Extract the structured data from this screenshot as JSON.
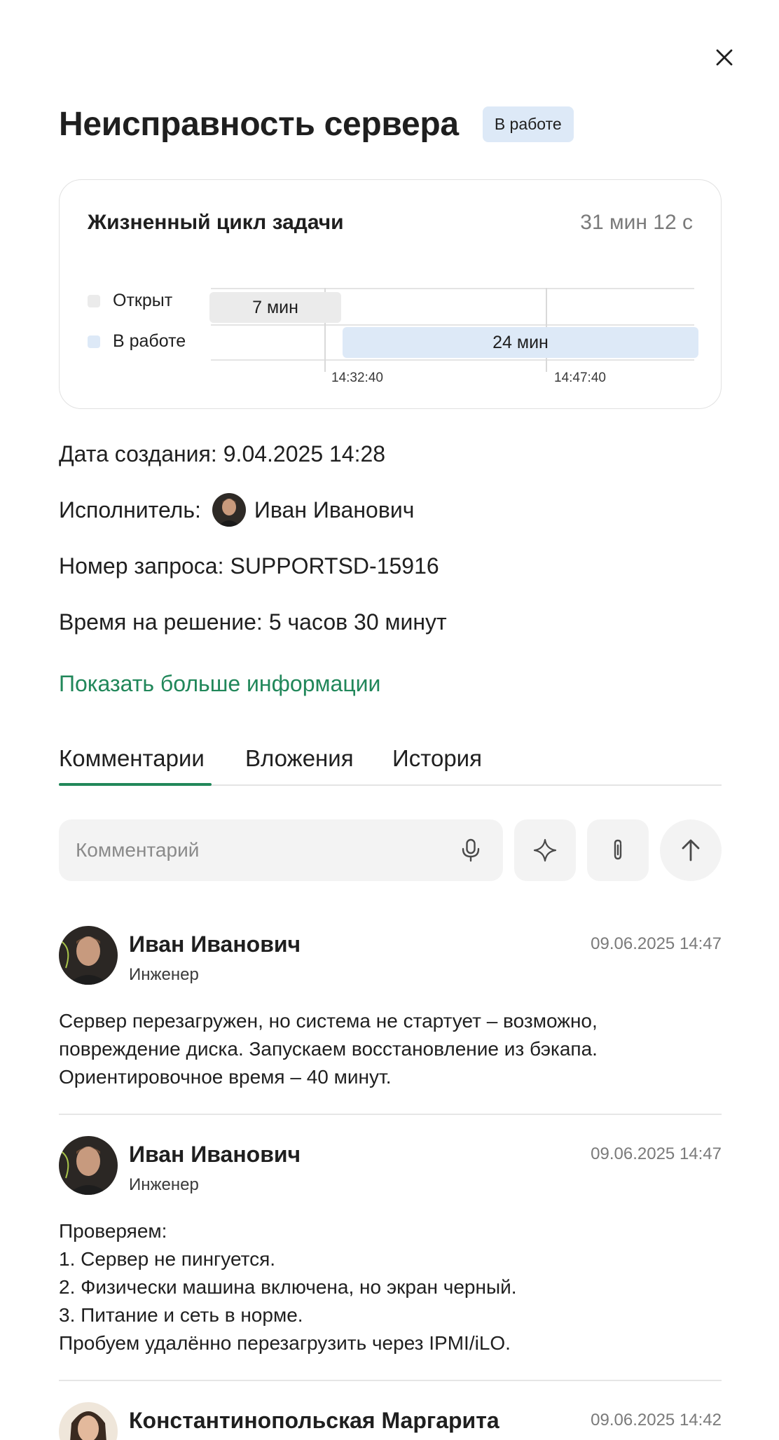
{
  "title": "Неисправность сервера",
  "status": "В работе",
  "lifecycle": {
    "title": "Жизненный цикл задачи",
    "total": "31 мин 12 с",
    "states": [
      {
        "label": "Открыт",
        "duration": "7 мин",
        "color": "#ebebeb"
      },
      {
        "label": "В работе",
        "duration": "24 мин",
        "color": "#dde9f7"
      }
    ],
    "ticks": [
      "14:32:40",
      "14:47:40"
    ]
  },
  "info": {
    "created_label": "Дата создания:",
    "created_value": "9.04.2025 14:28",
    "assignee_label": "Исполнитель:",
    "assignee_name": "Иван Иванович",
    "request_label": "Номер запроса:",
    "request_value": "SUPPORTSD-15916",
    "resolve_label": "Время на решение:",
    "resolve_value": "5 часов 30 минут"
  },
  "more_link": "Показать больше информации",
  "tabs": [
    {
      "label": "Комментарии",
      "active": true
    },
    {
      "label": "Вложения",
      "active": false
    },
    {
      "label": "История",
      "active": false
    }
  ],
  "composer": {
    "placeholder": "Комментарий",
    "mic_icon": "microphone-icon",
    "ai_icon": "sparkle-icon",
    "attach_icon": "paperclip-icon",
    "send_icon": "arrow-up-icon"
  },
  "comments": [
    {
      "author": "Иван Иванович",
      "role": "Инженер",
      "time": "09.06.2025 14:47",
      "lines": [
        "Сервер перезагружен, но система не стартует – возможно,",
        "повреждение диска. Запускаем восстановление из бэкапа.",
        "Ориентировочное время – 40 минут."
      ]
    },
    {
      "author": "Иван Иванович",
      "role": "Инженер",
      "time": "09.06.2025 14:47",
      "lines": [
        "Проверяем:",
        "1. Сервер не пингуется.",
        "2. Физически машина включена, но экран черный.",
        "3. Питание и сеть в норме.",
        "Пробуем удалённо перезагрузить через IPMI/iLO."
      ]
    },
    {
      "author": "Константинопольская Маргарита",
      "role": "",
      "time": "09.06.2025 14:42",
      "lines": []
    }
  ],
  "colors": {
    "accent": "#21875a",
    "status_badge_bg": "#dde9f7",
    "muted_text": "#7a7a7a"
  }
}
